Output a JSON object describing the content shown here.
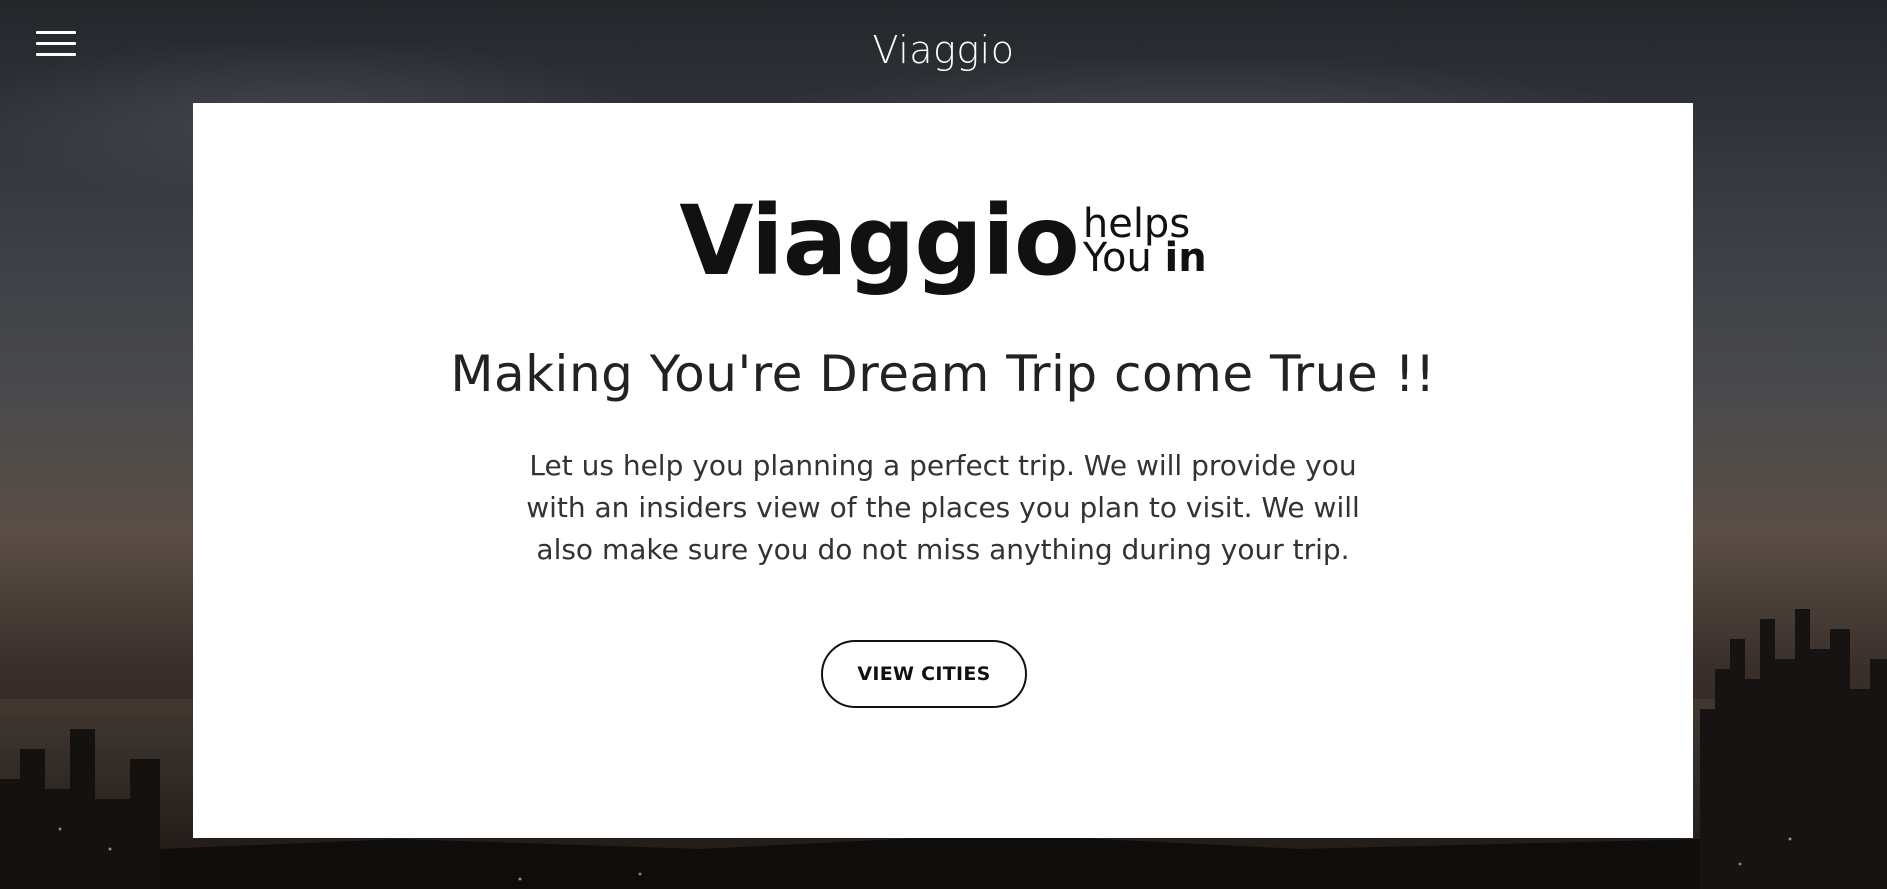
{
  "header": {
    "brand": "Viaggio",
    "menu_icon": "hamburger-menu-icon"
  },
  "hero": {
    "logo_main": "Viaggio",
    "logo_side_line1": "helps",
    "logo_side_line2_prefix": "You ",
    "logo_side_line2_bold": "in",
    "headline": "Making You're Dream Trip come True !!",
    "description": "Let us help you planning a perfect trip. We will provide you with an insiders view of the places you plan to visit. We will also make sure you do not miss anything during your trip.",
    "cta_label": "VIEW CITIES"
  },
  "colors": {
    "card_bg": "#ffffff",
    "text_dark": "#111111",
    "header_text": "#ffffff"
  }
}
